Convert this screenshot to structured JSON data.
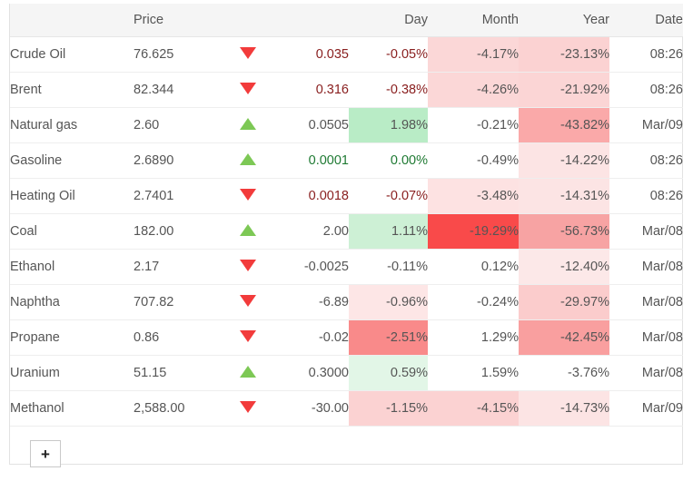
{
  "table": {
    "columns": [
      {
        "key": "name",
        "label": ""
      },
      {
        "key": "price",
        "label": "Price"
      },
      {
        "key": "arrow",
        "label": ""
      },
      {
        "key": "change",
        "label": ""
      },
      {
        "key": "day",
        "label": "Day"
      },
      {
        "key": "month",
        "label": "Month"
      },
      {
        "key": "year",
        "label": "Year"
      },
      {
        "key": "date",
        "label": "Date"
      }
    ],
    "rows": [
      {
        "name": "Crude Oil",
        "price": "76.625",
        "direction": "down",
        "arrow_icon": "triangle-down-icon",
        "change": "0.035",
        "change_color": "#8a2020",
        "day": "-0.05%",
        "day_bg": "#ffffff",
        "day_color": "#8a2020",
        "month": "-4.17%",
        "month_bg": "#fbd7d7",
        "month_color": "#555555",
        "year": "-23.13%",
        "year_bg": "#fbd2d2",
        "year_color": "#555555",
        "date": "08:26"
      },
      {
        "name": "Brent",
        "price": "82.344",
        "direction": "down",
        "arrow_icon": "triangle-down-icon",
        "change": "0.316",
        "change_color": "#8a2020",
        "day": "-0.38%",
        "day_bg": "#ffffff",
        "day_color": "#8a2020",
        "month": "-4.26%",
        "month_bg": "#fbd7d7",
        "month_color": "#555555",
        "year": "-21.92%",
        "year_bg": "#fbd5d5",
        "year_color": "#555555",
        "date": "08:26"
      },
      {
        "name": "Natural gas",
        "price": "2.60",
        "direction": "up",
        "arrow_icon": "triangle-up-icon",
        "change": "0.0505",
        "change_color": "#555555",
        "day": "1.98%",
        "day_bg": "#b9ecc6",
        "day_color": "#555555",
        "month": "-0.21%",
        "month_bg": "#ffffff",
        "month_color": "#555555",
        "year": "-43.82%",
        "year_bg": "#faa9a9",
        "year_color": "#555555",
        "date": "Mar/09"
      },
      {
        "name": "Gasoline",
        "price": "2.6890",
        "direction": "up",
        "arrow_icon": "triangle-up-icon",
        "change": "0.0001",
        "change_color": "#1f7a33",
        "day": "0.00%",
        "day_bg": "#ffffff",
        "day_color": "#1f7a33",
        "month": "-0.49%",
        "month_bg": "#ffffff",
        "month_color": "#555555",
        "year": "-14.22%",
        "year_bg": "#fce4e4",
        "year_color": "#555555",
        "date": "08:26"
      },
      {
        "name": "Heating Oil",
        "price": "2.7401",
        "direction": "down",
        "arrow_icon": "triangle-down-icon",
        "change": "0.0018",
        "change_color": "#8a2020",
        "day": "-0.07%",
        "day_bg": "#ffffff",
        "day_color": "#8a2020",
        "month": "-3.48%",
        "month_bg": "#fde2e2",
        "month_color": "#555555",
        "year": "-14.31%",
        "year_bg": "#fce4e4",
        "year_color": "#555555",
        "date": "08:26"
      },
      {
        "name": "Coal",
        "price": "182.00",
        "direction": "up",
        "arrow_icon": "triangle-up-icon",
        "change": "2.00",
        "change_color": "#555555",
        "day": "1.11%",
        "day_bg": "#cdf0d5",
        "day_color": "#555555",
        "month": "-19.29%",
        "month_bg": "#f94a4a",
        "month_color": "#555555",
        "year": "-56.73%",
        "year_bg": "#f7a3a3",
        "year_color": "#555555",
        "date": "Mar/08"
      },
      {
        "name": "Ethanol",
        "price": "2.17",
        "direction": "down",
        "arrow_icon": "triangle-down-icon",
        "change": "-0.0025",
        "change_color": "#555555",
        "day": "-0.11%",
        "day_bg": "#ffffff",
        "day_color": "#555555",
        "month": "0.12%",
        "month_bg": "#ffffff",
        "month_color": "#555555",
        "year": "-12.40%",
        "year_bg": "#fce8e8",
        "year_color": "#555555",
        "date": "Mar/08"
      },
      {
        "name": "Naphtha",
        "price": "707.82",
        "direction": "down",
        "arrow_icon": "triangle-down-icon",
        "change": "-6.89",
        "change_color": "#555555",
        "day": "-0.96%",
        "day_bg": "#fde6e6",
        "day_color": "#555555",
        "month": "-0.24%",
        "month_bg": "#ffffff",
        "month_color": "#555555",
        "year": "-29.97%",
        "year_bg": "#fbcccc",
        "year_color": "#555555",
        "date": "Mar/08"
      },
      {
        "name": "Propane",
        "price": "0.86",
        "direction": "down",
        "arrow_icon": "triangle-down-icon",
        "change": "-0.02",
        "change_color": "#555555",
        "day": "-2.51%",
        "day_bg": "#f98a8a",
        "day_color": "#555555",
        "month": "1.29%",
        "month_bg": "#ffffff",
        "month_color": "#555555",
        "year": "-42.45%",
        "year_bg": "#f99f9f",
        "year_color": "#555555",
        "date": "Mar/08"
      },
      {
        "name": "Uranium",
        "price": "51.15",
        "direction": "up",
        "arrow_icon": "triangle-up-icon",
        "change": "0.3000",
        "change_color": "#555555",
        "day": "0.59%",
        "day_bg": "#e2f6e7",
        "day_color": "#555555",
        "month": "1.59%",
        "month_bg": "#ffffff",
        "month_color": "#555555",
        "year": "-3.76%",
        "year_bg": "#ffffff",
        "year_color": "#555555",
        "date": "Mar/08"
      },
      {
        "name": "Methanol",
        "price": "2,588.00",
        "direction": "down",
        "arrow_icon": "triangle-down-icon",
        "change": "-30.00",
        "change_color": "#555555",
        "day": "-1.15%",
        "day_bg": "#fbd2d2",
        "day_color": "#555555",
        "month": "-4.15%",
        "month_bg": "#fbd2d2",
        "month_color": "#555555",
        "year": "-14.73%",
        "year_bg": "#fce4e4",
        "year_color": "#555555",
        "date": "Mar/09"
      }
    ]
  },
  "footer": {
    "add_label": "+"
  }
}
